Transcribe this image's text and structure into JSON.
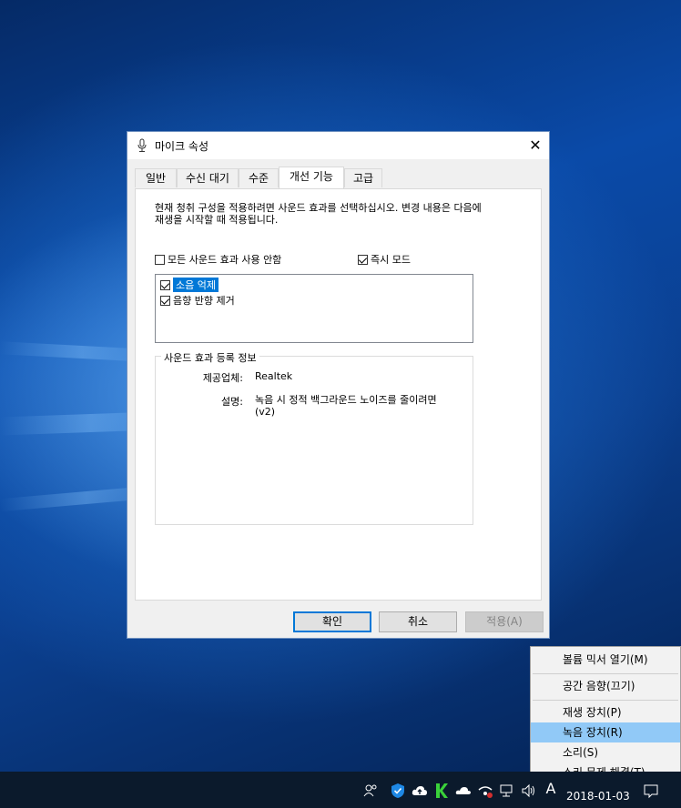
{
  "dialog": {
    "title": "마이크 속성",
    "close_glyph": "✕",
    "tabs": [
      "일반",
      "수신 대기",
      "수준",
      "개선 기능",
      "고급"
    ],
    "active_tab": "개선 기능",
    "description": "현재 청취 구성을 적용하려면 사운드 효과를 선택하십시오. 변경 내용은 다음에 재생을 시작할 때 적용됩니다.",
    "disable_all": {
      "label": "모든 사운드 효과 사용 안함",
      "checked": false
    },
    "immediate_mode": {
      "label": "즉시 모드",
      "checked": true
    },
    "effects": [
      {
        "label": "소음 억제",
        "checked": true,
        "selected": true
      },
      {
        "label": "음향 반향 제거",
        "checked": true,
        "selected": false
      }
    ],
    "info_group": {
      "title": "사운드 효과 등록 정보",
      "provider_label": "제공업체:",
      "provider_value": "Realtek",
      "desc_label": "설명:",
      "desc_value": "녹음 시 정적 백그라운드 노이즈를 줄이려면 (v2)"
    },
    "buttons": {
      "ok": "확인",
      "cancel": "취소",
      "apply": "적용(A)"
    }
  },
  "context_menu": {
    "items": [
      {
        "label": "볼륨 믹서 열기(M)",
        "highlighted": false
      },
      {
        "label": "공간 음향(끄기)",
        "highlighted": false
      },
      {
        "label": "재생 장치(P)",
        "highlighted": false
      },
      {
        "label": "녹음 장치(R)",
        "highlighted": true
      },
      {
        "label": "소리(S)",
        "highlighted": false
      },
      {
        "label": "소리 문제 해결(T)",
        "highlighted": false
      }
    ]
  },
  "taskbar": {
    "ime_indicator": "A",
    "date": "2018-01-03",
    "tray_icons": [
      "people-icon",
      "defender-icon",
      "cloud-upload-icon",
      "green-app-icon",
      "onedrive-icon",
      "network-error-icon",
      "network-icon",
      "volume-icon",
      "action-center-icon"
    ]
  },
  "colors": {
    "accent": "#0078d7",
    "menu_highlight": "#91c9f7",
    "taskbar": "#0b1a2c"
  }
}
